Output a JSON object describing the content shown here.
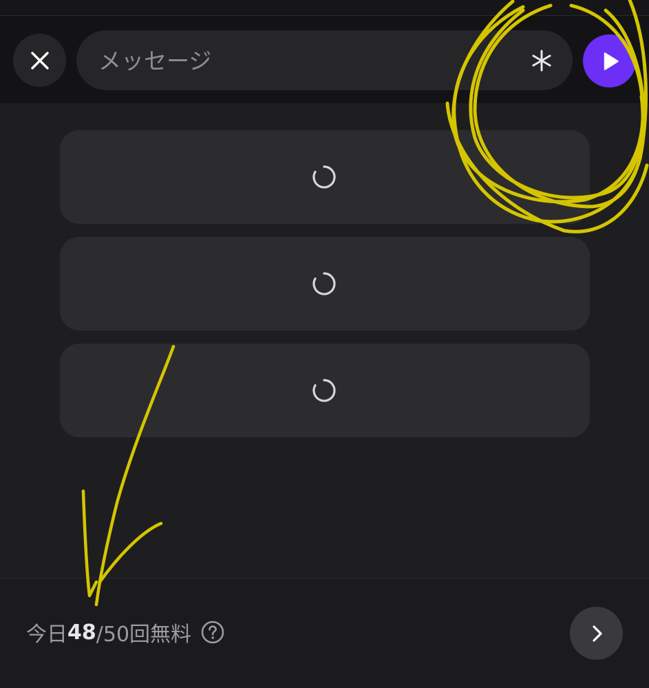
{
  "header": {
    "message_placeholder": "メッセージ",
    "message_value": ""
  },
  "cards": [
    {
      "state": "loading"
    },
    {
      "state": "loading"
    },
    {
      "state": "loading"
    }
  ],
  "footer": {
    "quota_prefix": "今日 ",
    "quota_used": "48",
    "quota_rest": "/50回無料"
  },
  "colors": {
    "send_button": "#6b2ff5",
    "annotation": "#d4c500"
  },
  "icons": {
    "close": "close-icon",
    "asterisk": "asterisk-icon",
    "send": "play-icon",
    "loading": "spinner-icon",
    "help": "question-circle-icon",
    "next": "chevron-right-icon"
  }
}
